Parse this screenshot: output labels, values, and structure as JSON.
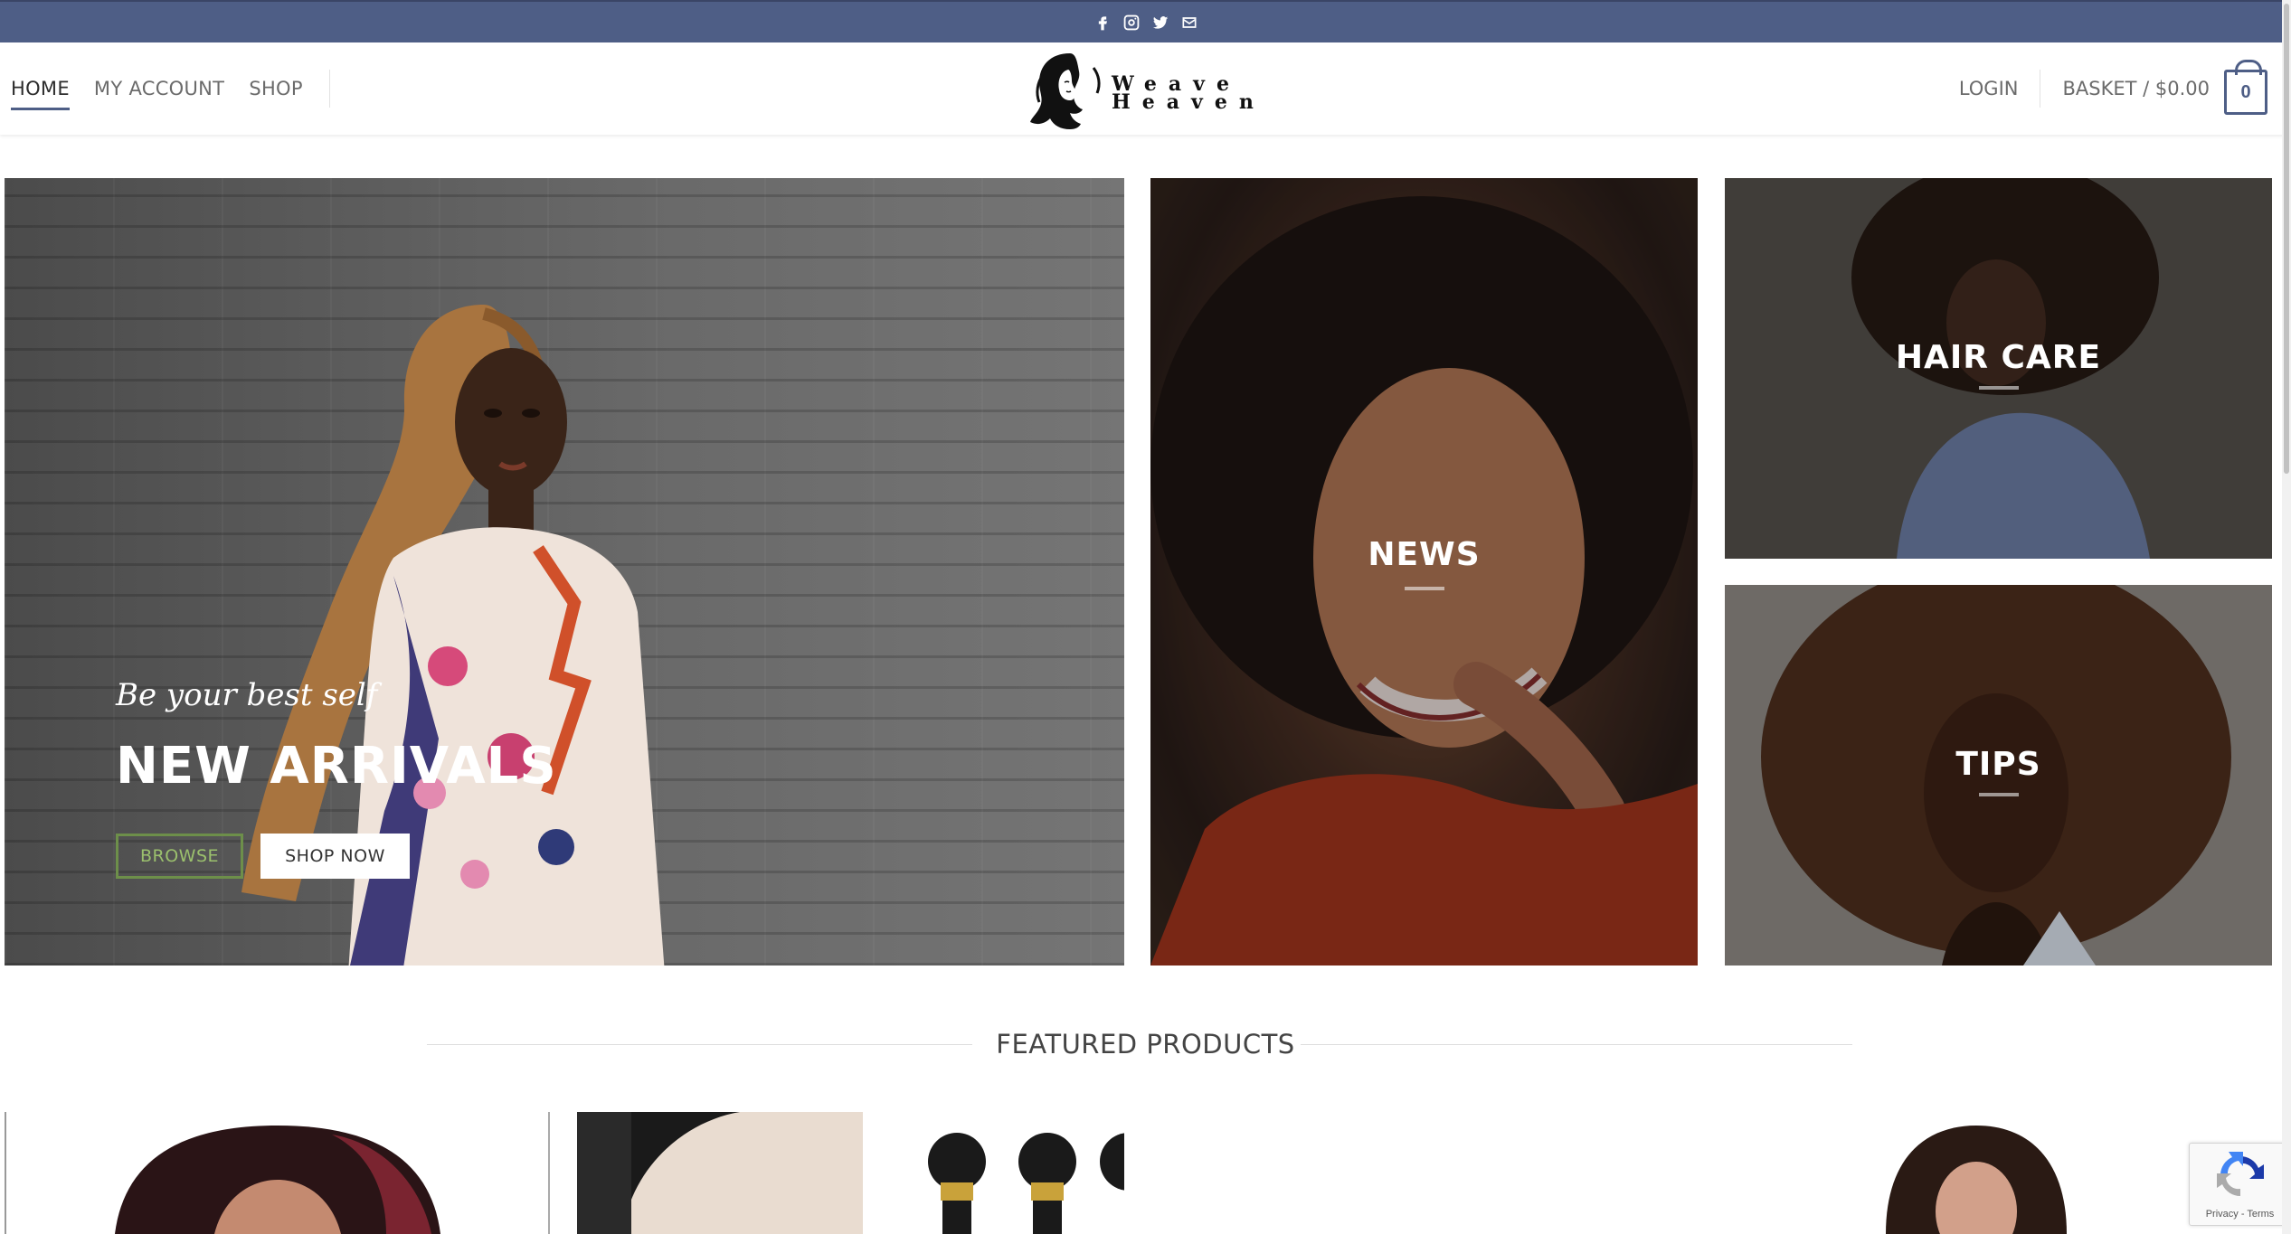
{
  "topbar": {
    "icons": [
      "facebook-icon",
      "instagram-icon",
      "twitter-icon",
      "envelope-icon"
    ],
    "color": "#4e5e86"
  },
  "nav": {
    "left": [
      {
        "label": "HOME",
        "active": true
      },
      {
        "label": "MY ACCOUNT",
        "active": false
      },
      {
        "label": "SHOP",
        "active": false
      }
    ],
    "login": "LOGIN",
    "basket": "BASKET / $0.00",
    "cart_count": "0"
  },
  "logo": {
    "line1": "Weave",
    "line2": "Heaven"
  },
  "banners": {
    "main": {
      "tagline": "Be your best self",
      "headline": "NEW ARRIVALS",
      "browse_label": "BROWSE",
      "shop_label": "SHOP NOW"
    },
    "news": {
      "label": "NEWS"
    },
    "hair_care": {
      "label": "HAIR CARE"
    },
    "tips": {
      "label": "TIPS"
    }
  },
  "featured": {
    "title": "FEATURED PRODUCTS"
  },
  "recaptcha": {
    "links": "Privacy - Terms"
  },
  "colors": {
    "brand": "#4e5e86",
    "browse_accent": "#6d8f4a"
  }
}
